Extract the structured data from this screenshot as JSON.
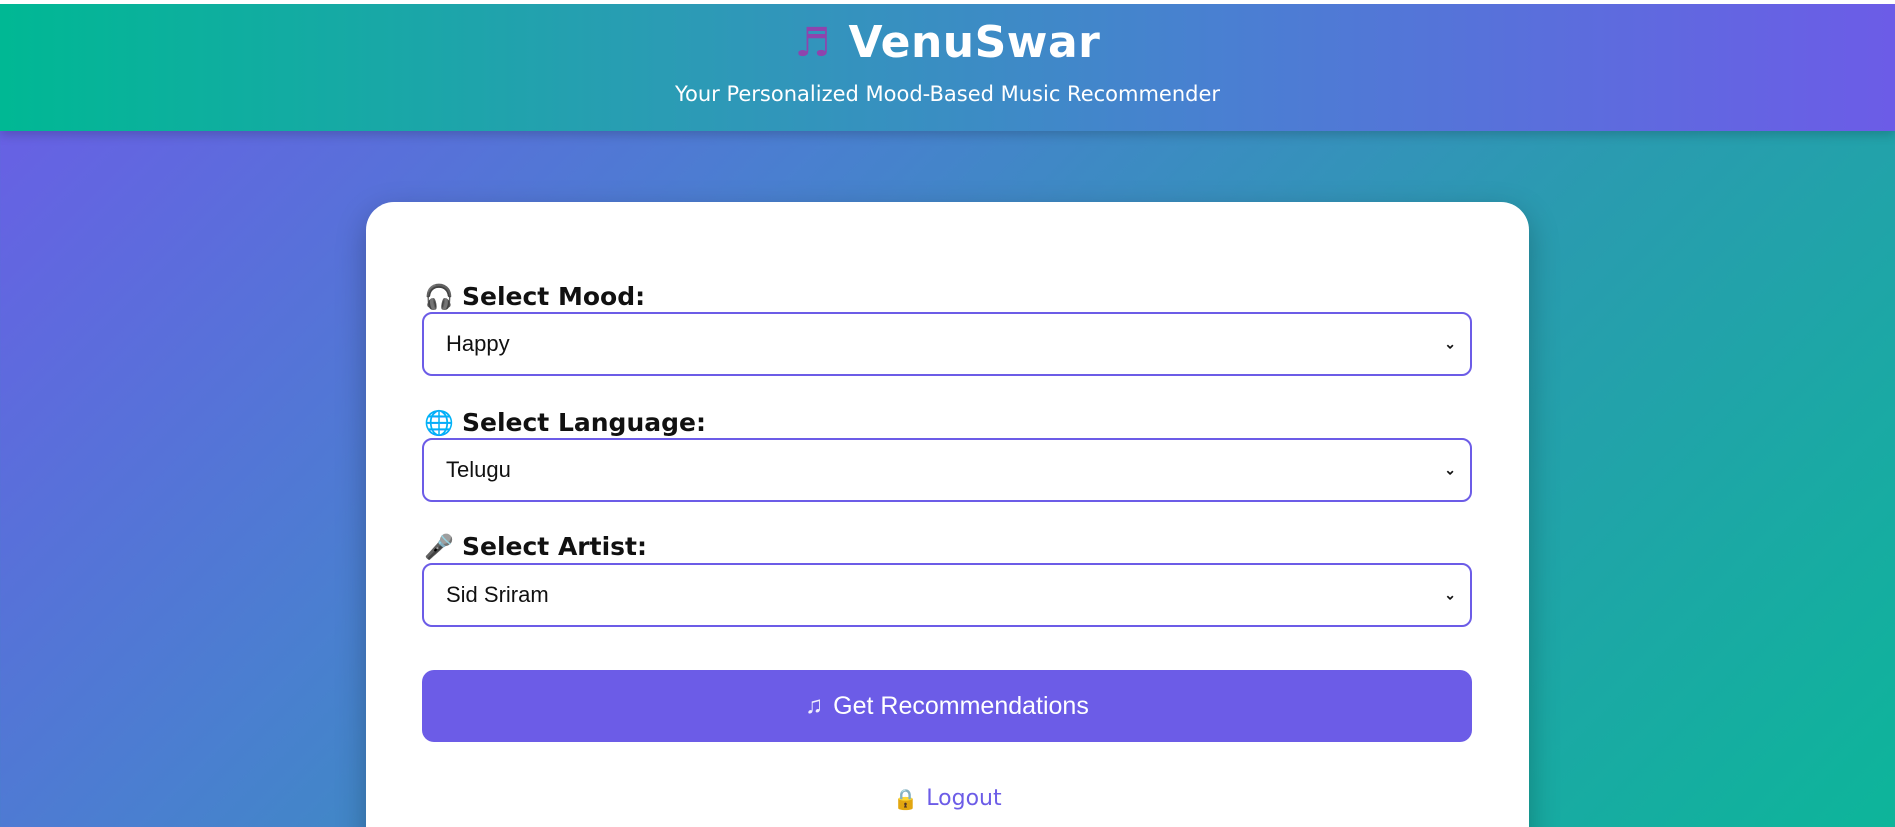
{
  "header": {
    "icon": "music-notes-icon",
    "title": "VenuSwar",
    "subtitle": "Your Personalized Mood-Based Music Recommender"
  },
  "form": {
    "mood": {
      "icon": "headphones-icon",
      "label": "Select Mood:",
      "value": "Happy"
    },
    "language": {
      "icon": "globe-icon",
      "label": "Select Language:",
      "value": "Telugu"
    },
    "artist": {
      "icon": "microphone-icon",
      "label": "Select Artist:",
      "value": "Sid Sriram"
    },
    "submit": {
      "icon": "music-note-icon",
      "label": "Get Recommendations"
    }
  },
  "logout": {
    "icon": "lock-icon",
    "label": "Logout"
  },
  "colors": {
    "accent": "#6c5ce7",
    "header_gradient_start": "#00b894",
    "header_gradient_end": "#6c5ce7"
  }
}
